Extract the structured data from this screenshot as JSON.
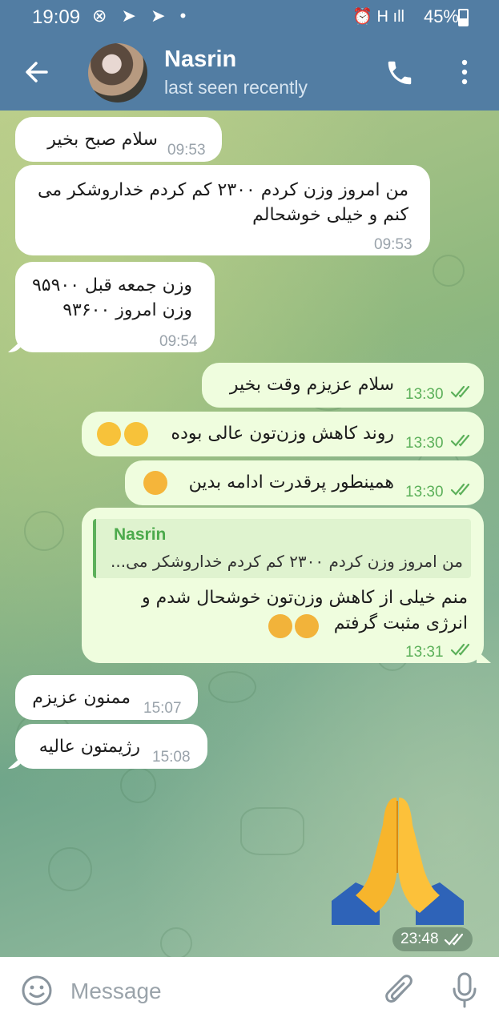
{
  "status": {
    "time": "19:09",
    "battery": "45%",
    "left_icons": "⊗ ➤ ➤ •",
    "right_icons": "⏰ H ıll"
  },
  "header": {
    "name": "Nasrin",
    "status": "last seen recently"
  },
  "messages": [
    {
      "text": "سلام صبح بخیر",
      "time": "09:53"
    },
    {
      "line1": "من امروز وزن کردم ۲۳۰۰ کم کردم خداروشکر می",
      "line2": "کنم و خیلی خوشحالم",
      "time": "09:53"
    },
    {
      "line1": "وزن جمعه قبل ۹۵۹۰۰",
      "line2": "وزن امروز ۹۳۶۰۰",
      "time": "09:54"
    },
    {
      "text": "سلام عزیزم وقت بخیر",
      "time": "13:30"
    },
    {
      "text": "روند کاهش وزن‌تون عالی بوده",
      "time": "13:30"
    },
    {
      "text": "همینطور پرقدرت ادامه بدین",
      "time": "13:30"
    },
    {
      "reply_name": "Nasrin",
      "reply_text": "من امروز وزن کردم ۲۳۰۰ کم کردم خداروشکر می...",
      "line1": "منم خیلی از کاهش وزن‌تون خوشحال شدم و",
      "line2": "انرژی مثبت گرفتم",
      "time": "13:31"
    },
    {
      "text": "ممنون عزیزم",
      "time": "15:07"
    },
    {
      "text": "رژیمتون عالیه",
      "time": "15:08"
    },
    {
      "emoji": "folded-hands",
      "time": "23:48"
    }
  ],
  "input": {
    "placeholder": "Message"
  },
  "colors": {
    "header": "#527da3",
    "outgoing": "#effdde",
    "incoming": "#ffffff",
    "accent": "#5cb05a"
  }
}
